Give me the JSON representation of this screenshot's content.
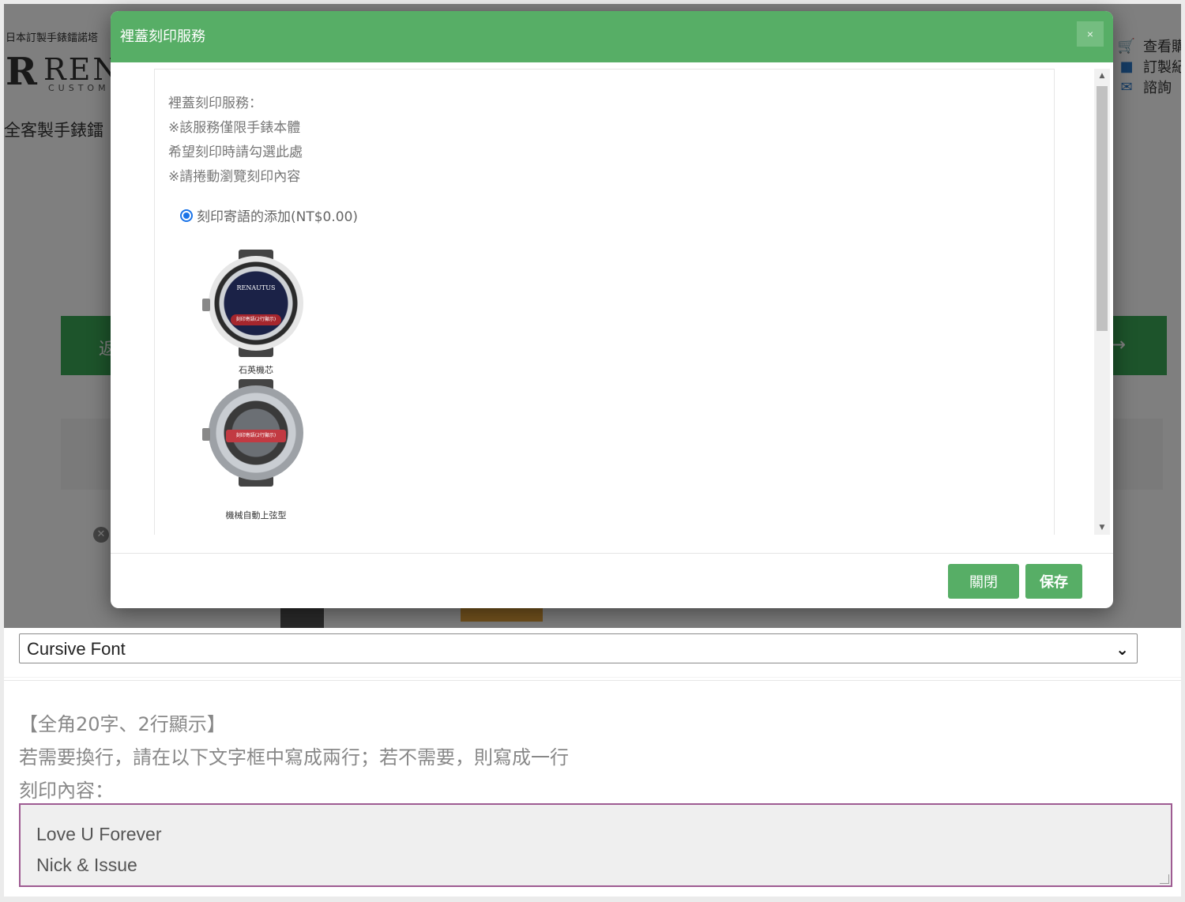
{
  "background": {
    "tagline": "日本訂製手錶鐳諾塔",
    "logo_mark": "R",
    "logo_text": "REN",
    "logo_sub": "CUSTOM",
    "heading": "全客製手錶鐳",
    "nav": [
      {
        "icon": "cart-icon",
        "label": "查看購"
      },
      {
        "icon": "briefcase-icon",
        "label": "訂製紀"
      },
      {
        "icon": "mail-icon",
        "label": "諮詢"
      }
    ],
    "left_button_label": "返",
    "right_button_label": "→"
  },
  "modal": {
    "title": "裡蓋刻印服務",
    "close_symbol": "×",
    "description": [
      "裡蓋刻印服務：",
      "※該服務僅限手錶本體",
      "希望刻印時請勾選此處",
      "※請捲動瀏覽刻印內容"
    ],
    "option": {
      "label": "刻印寄語的添加(NT$0.00)",
      "checked": true
    },
    "watches": [
      {
        "caption": "石英機芯",
        "brand": "RENAUTUS",
        "badge": "刻印寄語(2行顯示)"
      },
      {
        "caption": "機械自動上弦型",
        "badge": "刻印寄語(2行顯示)"
      }
    ],
    "buttons": {
      "close": "關閉",
      "save": "保存"
    }
  },
  "form": {
    "font_select": {
      "value": "Cursive Font"
    },
    "notes": [
      "【全角20字、2行顯示】",
      "若需要換行，請在以下文字框中寫成兩行；若不需要，則寫成一行",
      "刻印內容："
    ],
    "engraving_lines": [
      "Love U Forever",
      "Nick & Issue"
    ]
  },
  "colors": {
    "header_green": "#57ae66",
    "button_green": "#57ae66",
    "textarea_border": "#9e5b92",
    "radio_blue": "#1a73e8"
  }
}
